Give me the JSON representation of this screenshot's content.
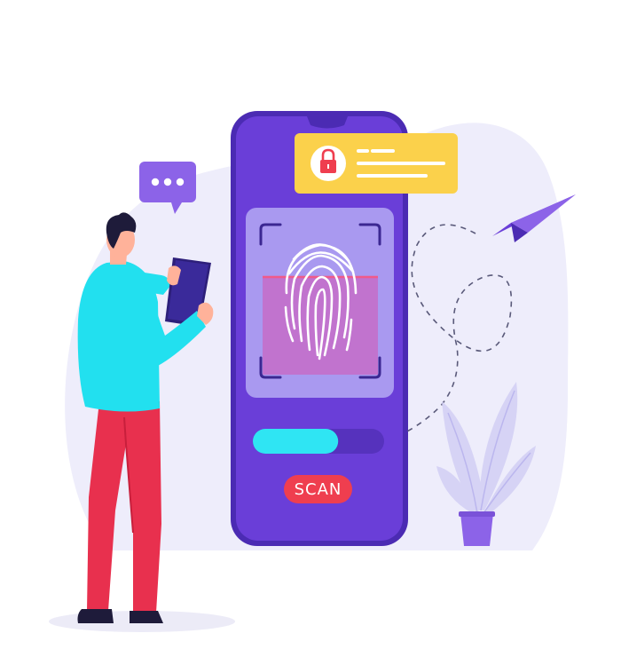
{
  "illustration": {
    "theme": "fingerprint-authentication",
    "colors": {
      "background_blob": "#eeedfb",
      "phone_body": "#6a3ed8",
      "phone_outline": "#4b2bb3",
      "screen_inner": "#a999f0",
      "scan_highlight": "#c173ce",
      "scan_line": "#f05a8a",
      "fingerprint": "#ffffff",
      "notification_bg": "#fbd14b",
      "lock_circle": "#ffffff",
      "lock_red": "#ef3e4f",
      "progress_track": "#5632bd",
      "progress_fill": "#2fe5f3",
      "scan_button": "#ef3e4f",
      "speech_bubble": "#8c63e8",
      "paper_plane": "#8c63e8",
      "shirt": "#22e0ef",
      "pants": "#e8304e",
      "skin": "#ffb29a",
      "hair": "#1e1b3a",
      "plant_leaves": "#d6d3f5",
      "pot": "#8c63e8"
    },
    "icons": [
      "lock-icon",
      "fingerprint-icon",
      "paper-plane-icon",
      "speech-bubble-icon",
      "plant-icon"
    ]
  },
  "phone": {
    "scan_button_label": "SCAN",
    "progress_fraction": 0.65
  }
}
